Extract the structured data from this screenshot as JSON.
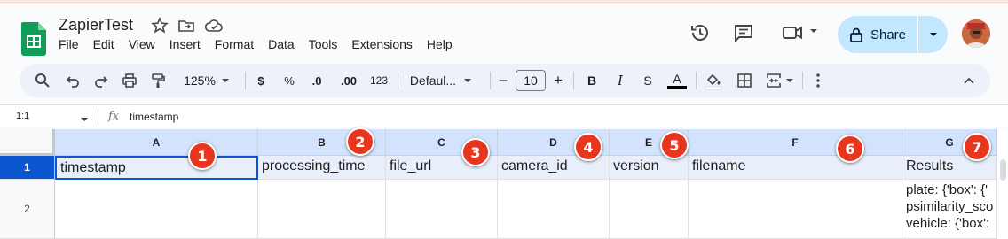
{
  "app": {
    "title": "ZapierTest",
    "menu": [
      "File",
      "Edit",
      "View",
      "Insert",
      "Format",
      "Data",
      "Tools",
      "Extensions",
      "Help"
    ],
    "share_label": "Share",
    "brand_color": "#0f9d58"
  },
  "toolbar": {
    "zoom": "125%",
    "currency": "$",
    "percent": "%",
    "dec_decrease": ".0",
    "dec_increase": ".00",
    "number_format": "123",
    "font": "Defaul...",
    "font_size": "10",
    "minus": "–",
    "plus": "+",
    "bold": "B",
    "italic": "I",
    "strike": "S",
    "text_color": "A",
    "text_color_swatch": "#000000"
  },
  "formula_bar": {
    "name_box": "1:1",
    "fx": "fx",
    "value": "timestamp"
  },
  "sheet": {
    "columns": [
      "A",
      "B",
      "C",
      "D",
      "E",
      "F",
      "G"
    ],
    "rows": [
      "1",
      "2"
    ],
    "row1": [
      "timestamp",
      "processing_time",
      "file_url",
      "camera_id",
      "version",
      "filename",
      "Results"
    ],
    "row2_g": [
      "plate: {'box': {'",
      "psimilarity_sco",
      "vehicle: {'box':"
    ]
  },
  "badges": [
    "1",
    "2",
    "3",
    "4",
    "5",
    "6",
    "7"
  ],
  "badge_color": "#e8361e",
  "selection_color": "#0b57d0"
}
